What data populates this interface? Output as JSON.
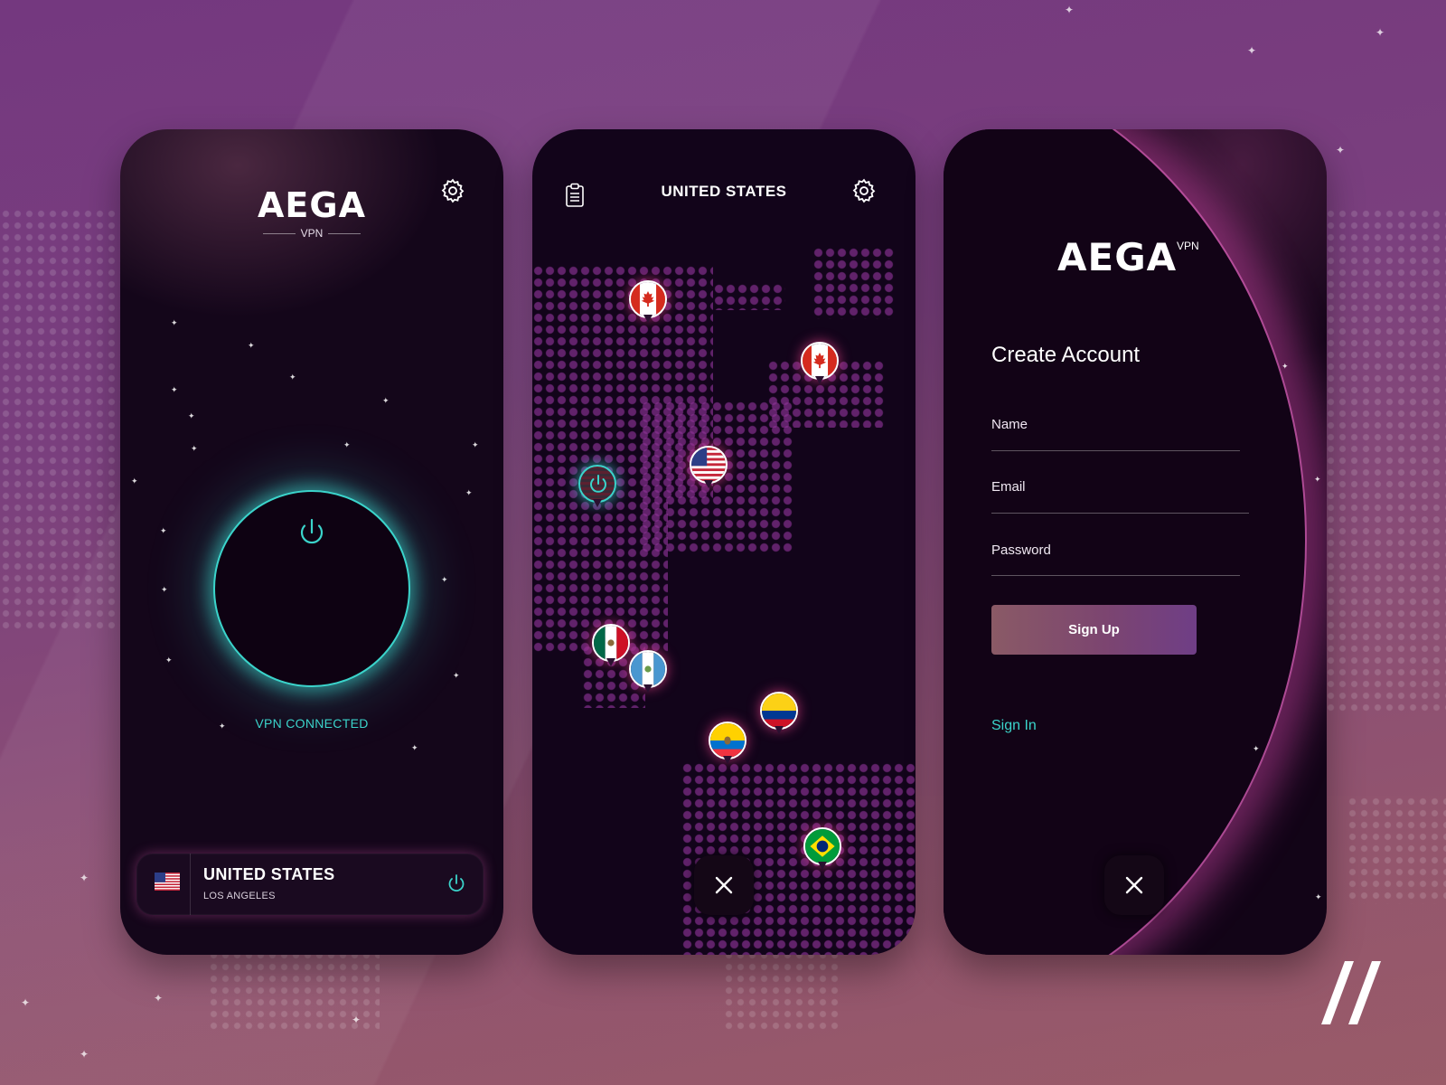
{
  "screen_main": {
    "logo": "AEGA",
    "logo_sub": "VPN",
    "status": "VPN CONNECTED",
    "location": {
      "country": "UNITED STATES",
      "city": "LOS ANGELES",
      "flag": "us-flag"
    }
  },
  "screen_map": {
    "title": "UNITED STATES",
    "pins": [
      "canada-flag",
      "canada-flag",
      "us-flag",
      "us-flag-active",
      "mexico-flag",
      "guatemala-flag",
      "colombia-flag",
      "ecuador-flag",
      "brazil-flag"
    ]
  },
  "screen_signup": {
    "logo": "AEGA",
    "logo_sub": "VPN",
    "title": "Create Account",
    "fields": {
      "name": "Name",
      "email": "Email",
      "password": "Password"
    },
    "submit": "Sign Up",
    "signin": "Sign In"
  },
  "colors": {
    "accent": "#3bd4cb",
    "glow": "#d64ea8",
    "background": "#74387f"
  }
}
